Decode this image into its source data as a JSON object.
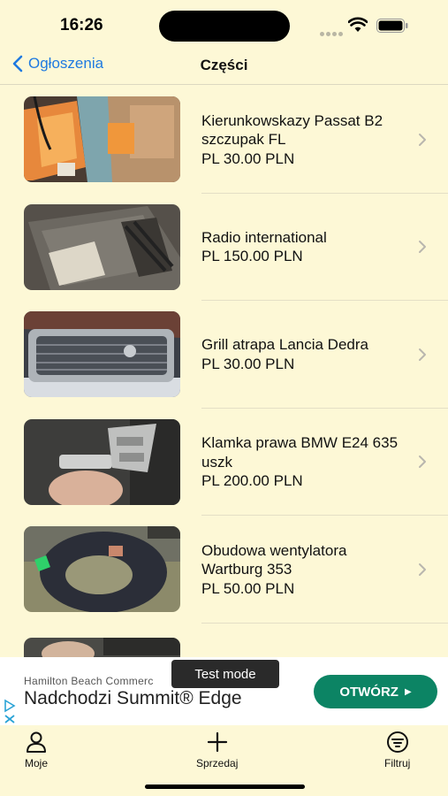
{
  "status_bar": {
    "time": "16:26"
  },
  "nav": {
    "back_label": "Ogłoszenia",
    "title": "Części"
  },
  "listings": [
    {
      "title": "Kierunkowskazy Passat B2 szczupak FL",
      "price": "PL  30.00 PLN",
      "image": "turn-signal-photo"
    },
    {
      "title": "Radio international",
      "price": "PL  150.00 PLN",
      "image": "radio-photo"
    },
    {
      "title": "Grill atrapa Lancia Dedra",
      "price": "PL  30.00 PLN",
      "image": "grill-photo"
    },
    {
      "title": "Klamka prawa BMW E24 635 uszk",
      "price": "PL  200.00 PLN",
      "image": "door-handle-photo"
    },
    {
      "title": "Obudowa wentylatora Wartburg 353",
      "price": "PL  50.00 PLN",
      "image": "fan-housing-photo"
    }
  ],
  "ad": {
    "advertiser": "Hamilton Beach Commerc",
    "headline": "Nadchodzi Summit® Edge",
    "cta": "OTWÓRZ",
    "test_mode": "Test mode",
    "cta_color": "#0c8464"
  },
  "tabs": [
    {
      "label": "Moje",
      "icon": "person-icon"
    },
    {
      "label": "Sprzedaj",
      "icon": "plus-icon"
    },
    {
      "label": "Filtruj",
      "icon": "filter-icon"
    }
  ],
  "colors": {
    "background": "#fdf8d6",
    "accent": "#1f7ae0"
  }
}
